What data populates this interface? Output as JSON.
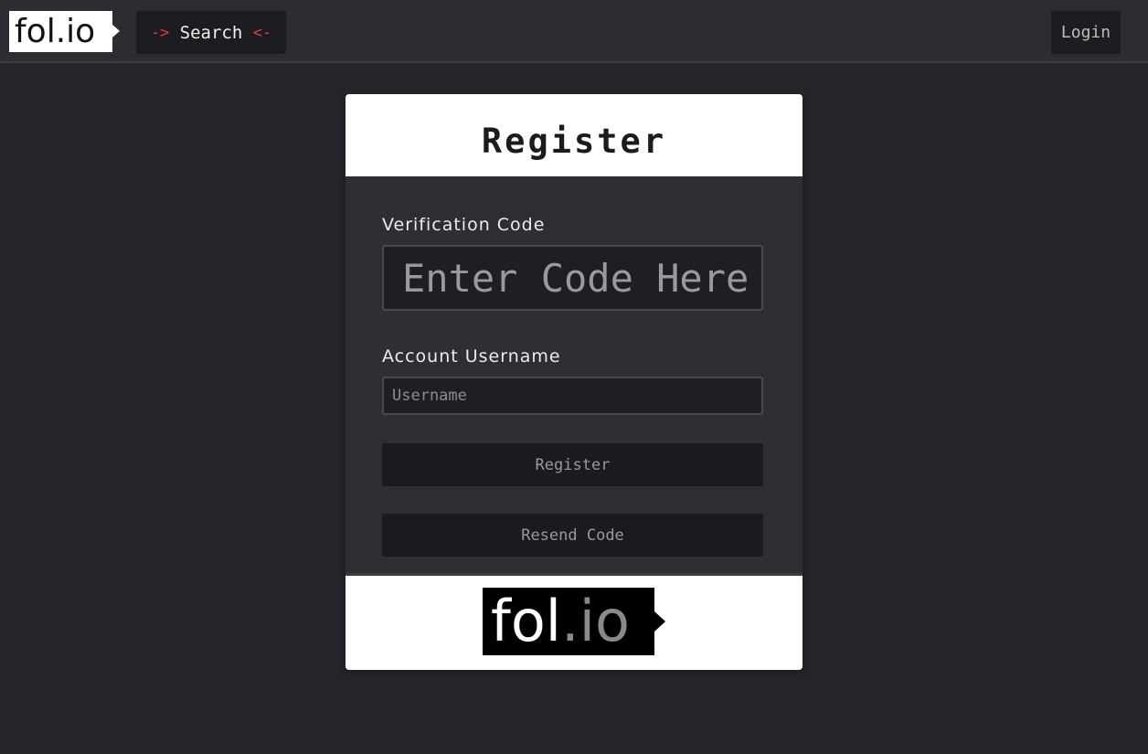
{
  "header": {
    "logo_text": "fol.io",
    "search": {
      "arrow_left": "->",
      "label": "Search",
      "arrow_right": "<-"
    },
    "login_label": "Login"
  },
  "form": {
    "title": "Register",
    "verification": {
      "label": "Verification Code",
      "placeholder": "Enter Code Here",
      "value": ""
    },
    "username": {
      "label": "Account Username",
      "placeholder": "Username",
      "value": ""
    },
    "register_label": "Register",
    "resend_label": "Resend Code"
  },
  "footer_logo": {
    "main": "fol",
    "dot": ".",
    "suffix": "io"
  },
  "colors": {
    "accent_arrow": "#e8384f",
    "page_bg": "#26252b",
    "card_body_bg": "#2f2e34",
    "button_bg": "#1b1a1e"
  }
}
